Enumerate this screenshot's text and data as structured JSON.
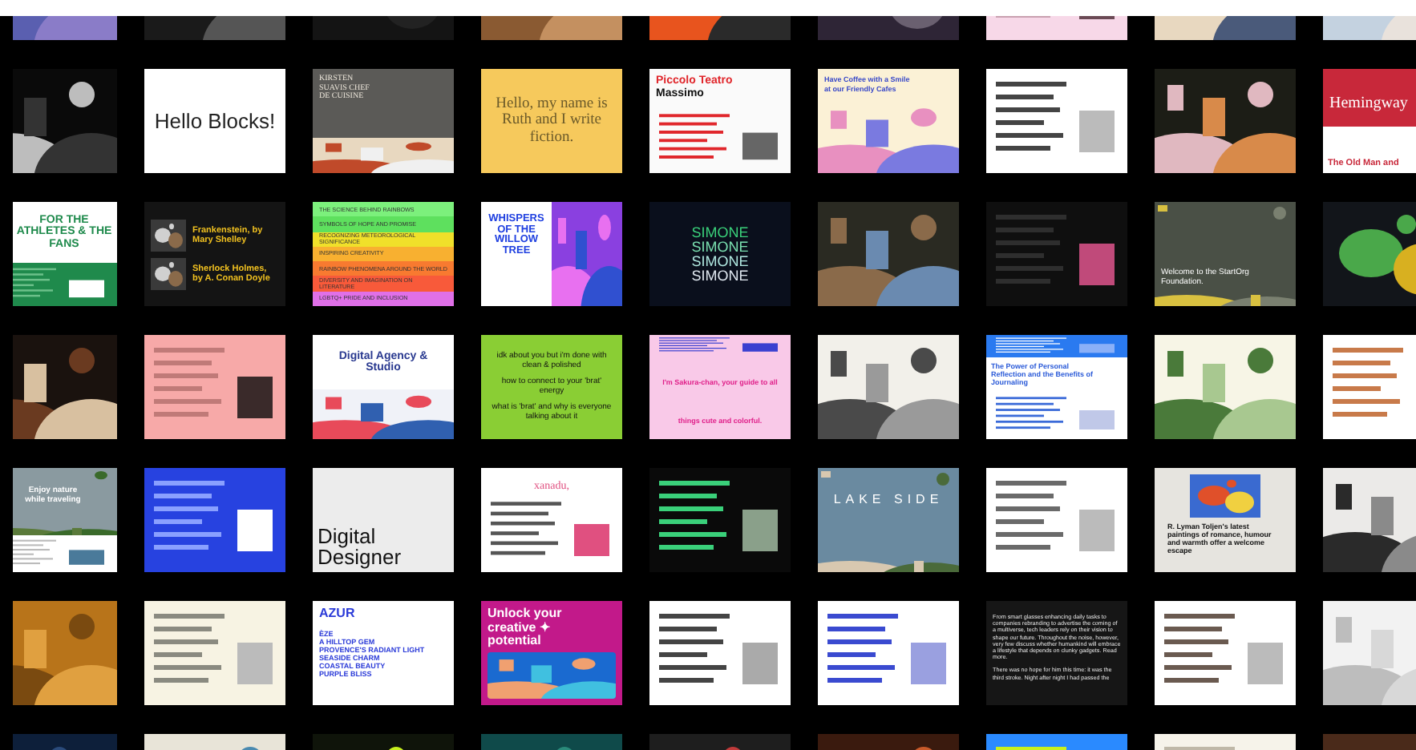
{
  "rows": [
    {
      "tiles": [
        {
          "kind": "picture"
        },
        {
          "kind": "picture"
        },
        {
          "kind": "picture"
        },
        {
          "kind": "picture"
        },
        {
          "kind": "picture"
        },
        {
          "kind": "picture"
        },
        {
          "kind": "picture"
        },
        {
          "kind": "picture"
        },
        {
          "kind": "picture"
        }
      ]
    },
    {
      "tiles": [
        {
          "kind": "picture"
        },
        {
          "kind": "page",
          "texts": [
            "Hello Blocks!"
          ]
        },
        {
          "kind": "page",
          "texts": [
            "KIRSTEN SUAVIS CHEF DE CUISINE"
          ]
        },
        {
          "kind": "page",
          "texts": [
            "Hello, my name is Ruth and I write fiction."
          ]
        },
        {
          "kind": "page",
          "texts": [
            "Piccolo Teatro",
            "Massimo"
          ]
        },
        {
          "kind": "page",
          "texts": [
            "Have Coffee with a Smile at our Friendly Cafes"
          ]
        },
        {
          "kind": "picture"
        },
        {
          "kind": "picture"
        },
        {
          "kind": "page",
          "texts": [
            "Hemingway",
            "The Old Man and"
          ]
        }
      ]
    },
    {
      "tiles": [
        {
          "kind": "page",
          "texts": [
            "FOR THE ATHLETES & THE FANS"
          ]
        },
        {
          "kind": "page",
          "texts": [
            "Frankenstein, by Mary Shelley",
            "Sherlock Holmes, by A. Conan Doyle"
          ]
        },
        {
          "kind": "page",
          "texts": [
            "THE SCIENCE BEHIND RAINBOWS",
            "SYMBOLS OF HOPE AND PROMISE",
            "RECOGNIZING METEOROLOGICAL SIGNIFICANCE",
            "INSPIRING CREATIVITY",
            "RAINBOW PHENOMENA AROUND THE WORLD",
            "DIVERSITY AND IMAGINATION ON LITERATURE",
            "LGBTQ+ PRIDE AND INCLUSION"
          ]
        },
        {
          "kind": "page",
          "texts": [
            "WHISPERS OF THE WILLOW TREE"
          ]
        },
        {
          "kind": "page",
          "texts": [
            "SIMONE",
            "SIMONE",
            "SIMONE",
            "SIMONE"
          ]
        },
        {
          "kind": "picture"
        },
        {
          "kind": "picture"
        },
        {
          "kind": "page",
          "texts": [
            "Welcome to the StartOrg Foundation."
          ]
        },
        {
          "kind": "picture"
        }
      ]
    },
    {
      "tiles": [
        {
          "kind": "picture"
        },
        {
          "kind": "picture"
        },
        {
          "kind": "page",
          "texts": [
            "Digital Agency & Studio"
          ]
        },
        {
          "kind": "page",
          "texts": [
            "idk about you but i'm done with clean & polished",
            "how to connect to your 'brat' energy",
            "what is 'brat' and why is everyone talking about it"
          ]
        },
        {
          "kind": "page",
          "texts": [
            "I'm Sakura-chan, your guide to all things cute and colorful."
          ]
        },
        {
          "kind": "picture"
        },
        {
          "kind": "page",
          "texts": [
            "The Power of Personal Reflection and the Benefits of Journaling"
          ]
        },
        {
          "kind": "picture"
        },
        {
          "kind": "picture"
        }
      ]
    },
    {
      "tiles": [
        {
          "kind": "page",
          "texts": [
            "Enjoy nature while traveling"
          ]
        },
        {
          "kind": "picture"
        },
        {
          "kind": "page",
          "texts": [
            "Digital Designer"
          ]
        },
        {
          "kind": "page",
          "texts": [
            "xanadu,"
          ]
        },
        {
          "kind": "picture"
        },
        {
          "kind": "page",
          "texts": [
            "LAKE SIDE"
          ]
        },
        {
          "kind": "picture"
        },
        {
          "kind": "page",
          "texts": [
            "R. Lyman Toljen's latest paintings of romance, humour and warmth offer a welcome escape"
          ]
        },
        {
          "kind": "picture"
        }
      ]
    },
    {
      "tiles": [
        {
          "kind": "picture"
        },
        {
          "kind": "picture"
        },
        {
          "kind": "page",
          "texts": [
            "AZUR",
            "ÈZE",
            "A HILLTOP GEM",
            "PROVENCE'S RADIANT LIGHT",
            "SEASIDE CHARM",
            "COASTAL BEAUTY",
            "PURPLE BLISS"
          ]
        },
        {
          "kind": "page",
          "texts": [
            "Unlock your creative ✦ potential"
          ]
        },
        {
          "kind": "picture"
        },
        {
          "kind": "picture"
        },
        {
          "kind": "page",
          "texts": [
            "From smart glasses enhancing daily tasks to companies rebranding to advertise the coming of a multiverse, tech leaders rely on their vision to shape our future. Throughout the noise, however, very few discuss whether humankind will embrace a lifestyle that depends on clunky gadgets. Read more.",
            "There was no hope for him this time: it was the third stroke. Night after night I had passed the"
          ]
        },
        {
          "kind": "picture"
        },
        {
          "kind": "picture"
        }
      ]
    },
    {
      "tiles": [
        {
          "kind": "picture"
        },
        {
          "kind": "picture"
        },
        {
          "kind": "picture"
        },
        {
          "kind": "picture"
        },
        {
          "kind": "picture"
        },
        {
          "kind": "picture"
        },
        {
          "kind": "picture"
        },
        {
          "kind": "picture"
        },
        {
          "kind": "picture"
        }
      ]
    }
  ]
}
